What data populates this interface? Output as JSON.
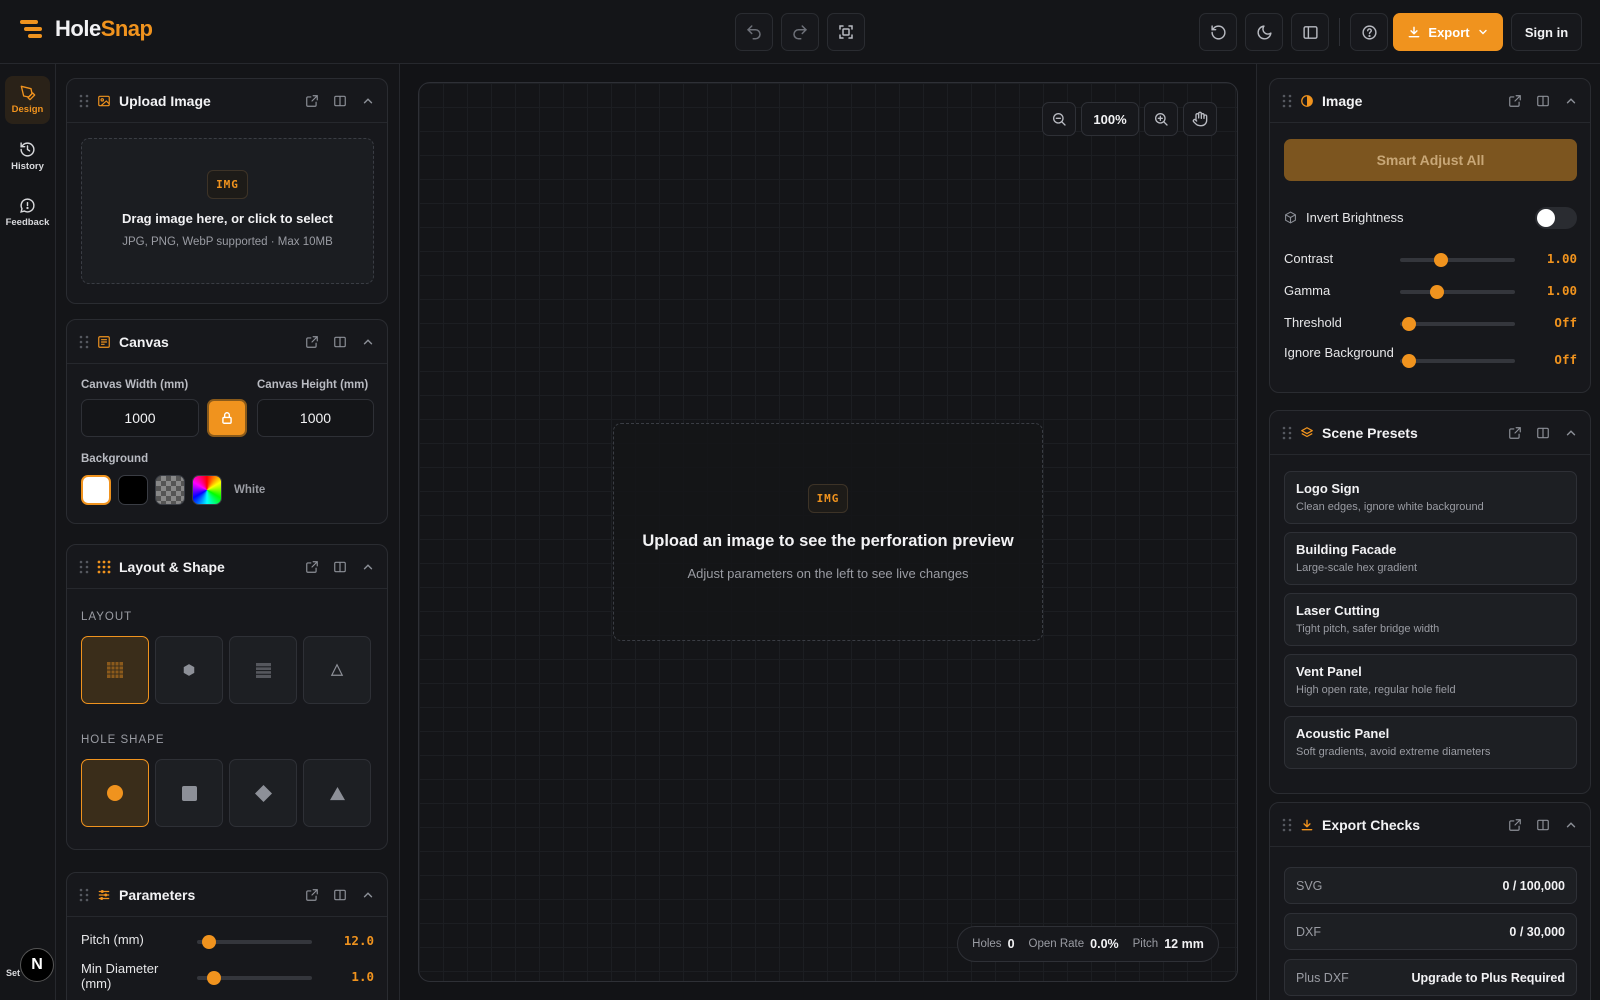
{
  "app": {
    "logo_a": "Hole",
    "logo_b": "Snap",
    "accent": "#f0931e"
  },
  "toolbar": {
    "undo_icon": "undo-icon",
    "redo_icon": "redo-icon",
    "fit_icon": "fit-screen-icon",
    "export_label": "Export",
    "signin_label": "Sign in"
  },
  "rail": {
    "items": [
      {
        "label": "Design",
        "icon": "pen-icon"
      },
      {
        "label": "History",
        "icon": "history-icon"
      },
      {
        "label": "Feedback",
        "icon": "feedback-icon"
      }
    ],
    "avatar_letter": "N",
    "settings_label": "Set"
  },
  "upload": {
    "title": "Upload Image",
    "badge": "IMG",
    "primary": "Drag image here, or click to select",
    "secondary": "JPG, PNG, WebP supported · Max 10MB"
  },
  "canvas_panel": {
    "title": "Canvas",
    "width_label": "Canvas Width (mm)",
    "height_label": "Canvas Height (mm)",
    "width_value": "1000",
    "height_value": "1000",
    "background_label": "Background",
    "background_selected": "White",
    "swatches": [
      "#ffffff",
      "#000000",
      "checker",
      "rainbow"
    ]
  },
  "layout_shape": {
    "title": "Layout & Shape",
    "layout_caption": "LAYOUT",
    "hole_shape_caption": "HOLE SHAPE",
    "layouts": [
      "grid",
      "hex",
      "lines",
      "triangle"
    ],
    "shapes": [
      "circle",
      "square",
      "diamond",
      "triangle"
    ]
  },
  "parameters": {
    "title": "Parameters",
    "items": [
      {
        "label": "Pitch (mm)",
        "value": "12.0",
        "level": 0.1
      },
      {
        "label": "Min Diameter (mm)",
        "value": "1.0",
        "level": 0.15
      }
    ]
  },
  "canvas_view": {
    "zoom": "100%",
    "badge": "IMG",
    "empty_title": "Upload an image to see the perforation preview",
    "empty_sub": "Adjust parameters on the left to see live changes",
    "status": {
      "holes_label": "Holes",
      "holes_value": "0",
      "open_label": "Open Rate",
      "open_value": "0.0%",
      "pitch_label": "Pitch",
      "pitch_value": "12 mm"
    }
  },
  "image_panel": {
    "title": "Image",
    "smart_label": "Smart Adjust All",
    "invert_label": "Invert Brightness",
    "invert_on": false,
    "sliders": [
      {
        "label": "Contrast",
        "value": "1.00",
        "level": 0.36
      },
      {
        "label": "Gamma",
        "value": "1.00",
        "level": 0.32
      },
      {
        "label": "Threshold",
        "value": "Off",
        "level": 0.08
      },
      {
        "label": "Ignore Background",
        "value": "Off",
        "level": 0.08
      }
    ]
  },
  "presets": {
    "title": "Scene Presets",
    "items": [
      {
        "name": "Logo Sign",
        "desc": "Clean edges, ignore white background"
      },
      {
        "name": "Building Facade",
        "desc": "Large-scale hex gradient"
      },
      {
        "name": "Laser Cutting",
        "desc": "Tight pitch, safer bridge width"
      },
      {
        "name": "Vent Panel",
        "desc": "High open rate, regular hole field"
      },
      {
        "name": "Acoustic Panel",
        "desc": "Soft gradients, avoid extreme diameters"
      }
    ]
  },
  "export_checks": {
    "title": "Export Checks",
    "rows": [
      {
        "key": "SVG",
        "value": "0 / 100,000"
      },
      {
        "key": "DXF",
        "value": "0 / 30,000"
      },
      {
        "key": "Plus DXF",
        "value": "Upgrade to Plus Required"
      }
    ]
  }
}
